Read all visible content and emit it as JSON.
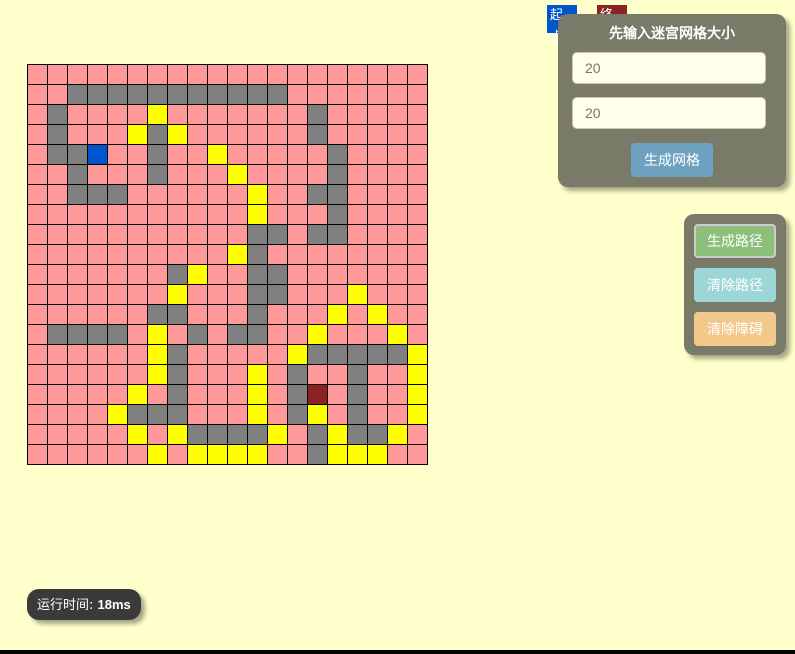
{
  "legend": {
    "start_label": "起点",
    "end_label": "终点"
  },
  "size_panel": {
    "title": "先输入迷宫网格大小",
    "rows_placeholder": "20",
    "cols_placeholder": "20",
    "generate_grid_label": "生成网格"
  },
  "actions": {
    "generate_path_label": "生成路径",
    "clear_path_label": "清除路径",
    "clear_obstacles_label": "清除障碍"
  },
  "runtime": {
    "label": "运行时间:",
    "value": "18ms"
  },
  "colors": {
    "empty": "#ff9999",
    "wall": "#808080",
    "path": "#ffff00",
    "start": "#0055cc",
    "end": "#8b2323",
    "background": "#ffffcc"
  },
  "maze": {
    "rows": 20,
    "cols": 20,
    "legend": {
      ".": "empty",
      "#": "wall",
      "*": "path",
      "S": "start",
      "E": "end"
    },
    "cells": [
      "....................",
      "..###########.......",
      ".#....*.......#.....",
      ".#...*#*......#.....",
      ".##S..#..*.....#....",
      "..#...#...*....#....",
      "..###......*..##....",
      "...........*...#....",
      "...........##.##....",
      "..........*#........",
      ".......#*..##.......",
      ".......*...##...*...",
      "......##...#...*.*..",
      ".####.*.#.##..*...*.",
      "......*#.....*#####*.",
      "......*#...*.#..#..*",
      ".....*.#...*.#E.#..*",
      "....*###...*.#*.#..*",
      ".....*.*####*.#*##*.",
      "......*.****..#***.."
    ]
  }
}
